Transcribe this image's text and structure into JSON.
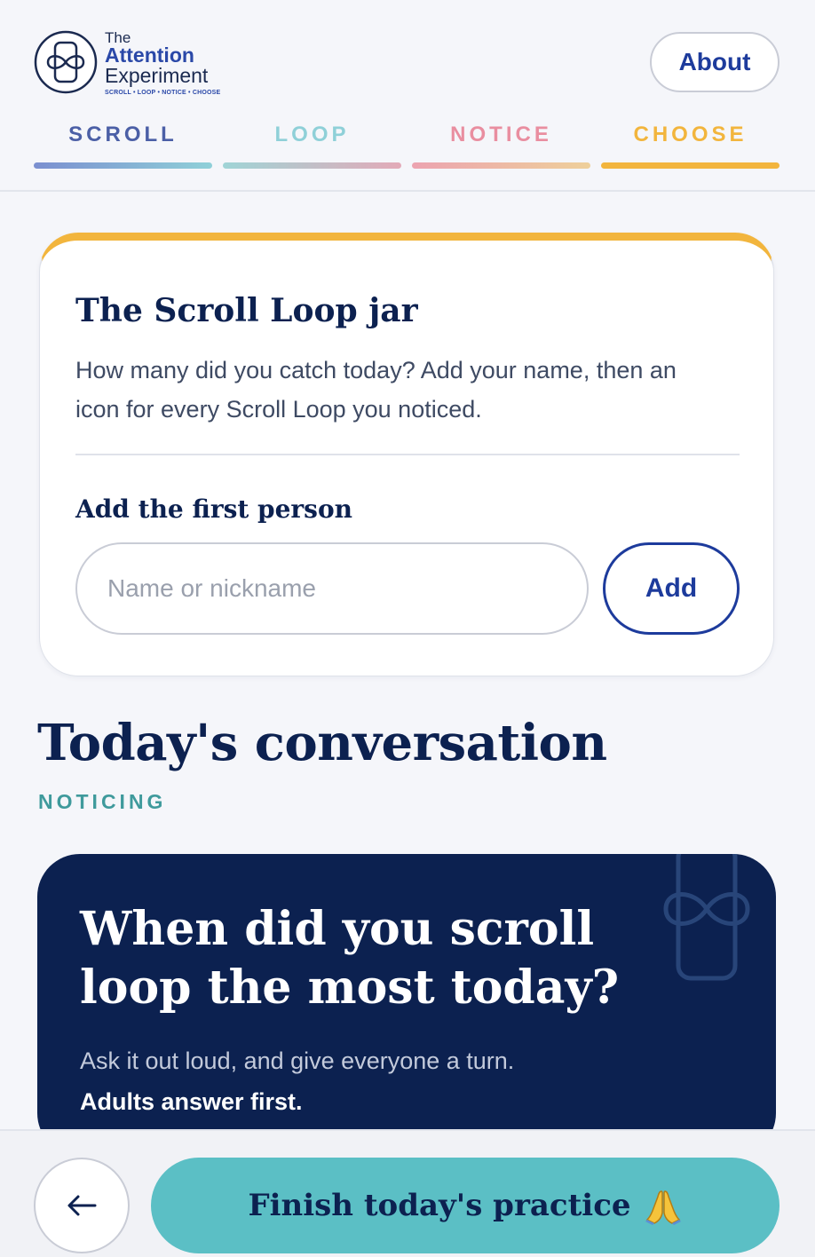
{
  "header": {
    "logo": {
      "the": "The",
      "attention": "Attention",
      "experiment": "Experiment",
      "tagline": "SCROLL • LOOP • NOTICE • CHOOSE"
    },
    "about_label": "About",
    "steps": [
      {
        "label": "SCROLL",
        "color": "#4b5fa6"
      },
      {
        "label": "LOOP",
        "color": "#8fd0d8"
      },
      {
        "label": "NOTICE",
        "color": "#e98ea0"
      },
      {
        "label": "CHOOSE",
        "color": "#f2b53d"
      }
    ]
  },
  "jar": {
    "title": "The Scroll Loop jar",
    "description": "How many did you catch today? Add your name, then an icon for every Scroll Loop you noticed.",
    "subtitle": "Add the first person",
    "input_placeholder": "Name or nickname",
    "input_value": "",
    "add_label": "Add"
  },
  "conversation": {
    "title": "Today's conversation",
    "tag": "NOTICING",
    "question": "When did you scroll loop the most today?",
    "hint": "Ask it out loud, and give everyone a turn.",
    "emphasis": "Adults answer first."
  },
  "footer": {
    "back_icon": "arrow-left-icon",
    "finish_label": "Finish today's practice",
    "finish_icon": "folded-hands-icon"
  },
  "colors": {
    "navy": "#0c2150",
    "accent_blue": "#1d3b9c",
    "teal": "#5bbfc5",
    "gold": "#f2b53d"
  }
}
